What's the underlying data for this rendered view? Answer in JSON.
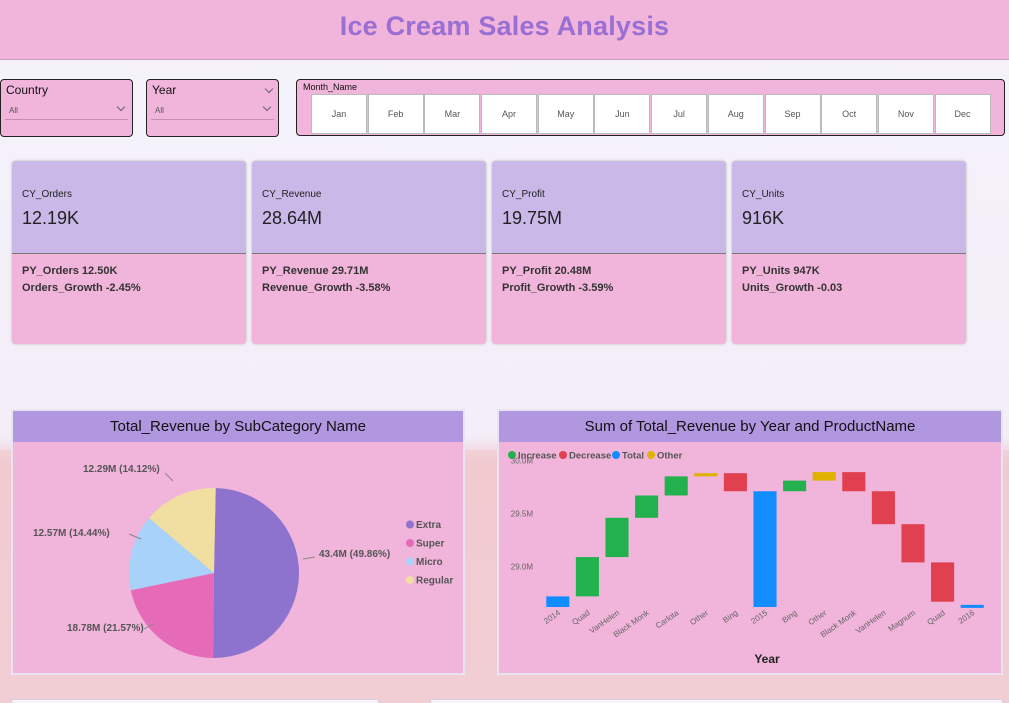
{
  "title": "Ice Cream Sales Analysis",
  "slicers": {
    "country": {
      "label": "Country",
      "value": "All"
    },
    "year": {
      "label": "Year",
      "value": "All"
    },
    "month": {
      "label": "Month_Name",
      "options": [
        "Jan",
        "Feb",
        "Mar",
        "Apr",
        "May",
        "Jun",
        "Jul",
        "Aug",
        "Sep",
        "Oct",
        "Nov",
        "Dec"
      ]
    }
  },
  "more_options": "...",
  "kpis": [
    {
      "label": "CY_Orders",
      "value": "12.19K",
      "py": "PY_Orders 12.50K",
      "growth": "Orders_Growth -2.45%"
    },
    {
      "label": "CY_Revenue",
      "value": "28.64M",
      "py": "PY_Revenue 29.71M",
      "growth": "Revenue_Growth -3.58%"
    },
    {
      "label": "CY_Profit",
      "value": "19.75M",
      "py": "PY_Profit 20.48M",
      "growth": "Profit_Growth -3.59%"
    },
    {
      "label": "CY_Units",
      "value": "916K",
      "py": "PY_Units 947K",
      "growth": "Units_Growth -0.03"
    }
  ],
  "colors": {
    "header_bg": "#f1b4db",
    "title_text": "#9a6fd4",
    "kpi_top": "#c9b8e8",
    "panel_title_bg": "#b196e0",
    "increase": "#22b14c",
    "decrease": "#e0404f",
    "total": "#118dff",
    "other": "#e0b200"
  },
  "chart_data": [
    {
      "type": "pie",
      "title": "Total_Revenue by SubCategory Name",
      "categories": [
        "Extra",
        "Super",
        "Micro",
        "Regular"
      ],
      "values": [
        43.4,
        18.78,
        12.57,
        12.29
      ],
      "data_labels": [
        "43.4M (49.86%)",
        "18.78M (21.57%)",
        "12.57M (14.44%)",
        "12.29M (14.12%)"
      ],
      "colors": [
        "#8e73ce",
        "#e56bb9",
        "#a9d2fb",
        "#f0dfa0"
      ],
      "legend_position": "right"
    },
    {
      "type": "bar",
      "subtype": "waterfall",
      "title": "Sum of Total_Revenue by Year and ProductName",
      "xlabel": "Year",
      "ylabel": "",
      "yticks": [
        "30.0M",
        "29.5M",
        "29.0M"
      ],
      "ylim": [
        28.62,
        30.07
      ],
      "legend": [
        "Increase",
        "Decrease",
        "Total",
        "Other"
      ],
      "legend_position": "top-left",
      "categories": [
        "2014",
        "Quad",
        "VanHelen",
        "Black Monk",
        "Carlota",
        "Other",
        "Bing",
        "2015",
        "Bing",
        "Other",
        "Black Monk",
        "VanHelen",
        "Magnum",
        "Quad",
        "2016"
      ],
      "values": [
        28.72,
        0.37,
        0.37,
        0.21,
        0.18,
        0.03,
        -0.17,
        29.71,
        0.1,
        0.08,
        -0.18,
        -0.31,
        -0.36,
        -0.37,
        28.64
      ],
      "kinds": [
        "total",
        "increase",
        "increase",
        "increase",
        "increase",
        "other",
        "decrease",
        "total",
        "increase",
        "other",
        "decrease",
        "decrease",
        "decrease",
        "decrease",
        "total"
      ]
    }
  ]
}
